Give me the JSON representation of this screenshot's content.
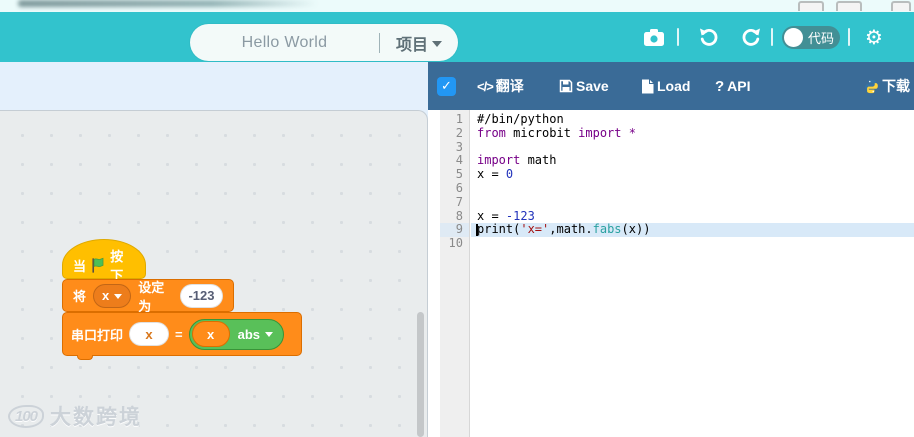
{
  "header": {
    "project_name": "Hello World",
    "menu_label": "项目",
    "code_toggle_label": "代码"
  },
  "code_toolbar": {
    "translate_icon": "</>",
    "translate": "翻译",
    "save": "Save",
    "load": "Load",
    "api_prefix": "?",
    "api": "API",
    "download": "下载",
    "checkbox_checked": "✓"
  },
  "editor": {
    "active_line": 9,
    "lines": [
      {
        "num": "1",
        "tokens": [
          [
            "comment",
            "#/bin/python"
          ]
        ]
      },
      {
        "num": "2",
        "tokens": [
          [
            "keyword",
            "from"
          ],
          [
            "plain",
            " microbit "
          ],
          [
            "keyword",
            "import"
          ],
          [
            "plain",
            " "
          ],
          [
            "keyword",
            "*"
          ]
        ]
      },
      {
        "num": "3",
        "tokens": []
      },
      {
        "num": "4",
        "tokens": [
          [
            "keyword",
            "import"
          ],
          [
            "plain",
            " math"
          ]
        ]
      },
      {
        "num": "5",
        "tokens": [
          [
            "plain",
            "x = "
          ],
          [
            "number",
            "0"
          ]
        ]
      },
      {
        "num": "6",
        "tokens": []
      },
      {
        "num": "7",
        "tokens": []
      },
      {
        "num": "8",
        "tokens": [
          [
            "plain",
            "x = "
          ],
          [
            "number",
            "-123"
          ]
        ]
      },
      {
        "num": "9",
        "tokens": [
          [
            "plain",
            "print("
          ],
          [
            "string",
            "'x='"
          ],
          [
            "plain",
            ",math."
          ],
          [
            "builtin",
            "fabs"
          ],
          [
            "plain",
            "(x))"
          ]
        ]
      },
      {
        "num": "10",
        "tokens": []
      }
    ]
  },
  "blocks": {
    "hat": {
      "text_before": "当",
      "text_after": "按下"
    },
    "set": {
      "verb": "将",
      "variable": "x",
      "label": "设定为",
      "value": "-123"
    },
    "print": {
      "label": "串口打印",
      "slot": "x",
      "operator": "=",
      "arg": "x",
      "func": "abs"
    }
  },
  "watermark": {
    "logo": "100",
    "text": "大数跨境"
  },
  "colors": {
    "teal": "#32c3cd",
    "toolbar_blue": "#3a6b97",
    "checkbox_blue": "#2297f4",
    "block_yellow": "#ffbf00",
    "block_orange": "#ff8c1a",
    "operator_green": "#59c059",
    "active_line_bg": "#d8e9f8"
  }
}
